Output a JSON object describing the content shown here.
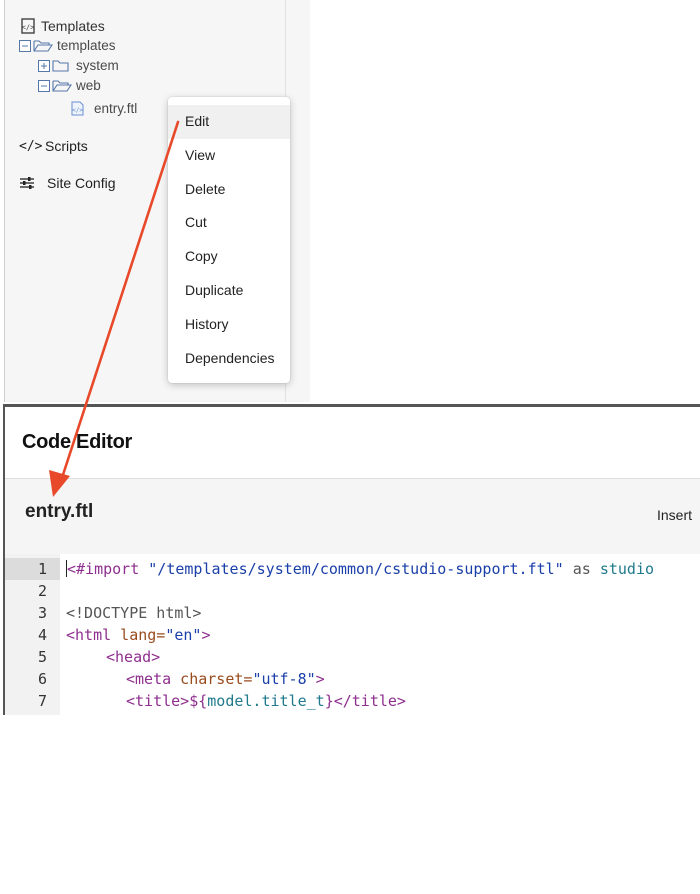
{
  "tree": {
    "root_label": "Templates",
    "folders": [
      {
        "label": "templates"
      },
      {
        "label": "system"
      },
      {
        "label": "web"
      }
    ],
    "file_label": "entry.ftl",
    "sections": [
      {
        "label": "Scripts",
        "icon": "code-icon"
      },
      {
        "label": "Site Config",
        "icon": "sliders-icon"
      }
    ]
  },
  "context_menu": {
    "items": [
      "Edit",
      "View",
      "Delete",
      "Cut",
      "Copy",
      "Duplicate",
      "History",
      "Dependencies"
    ],
    "highlighted": "Edit"
  },
  "editor": {
    "title": "Code Editor",
    "file_name": "entry.ftl",
    "insert_label": "Insert",
    "line_numbers": [
      "1",
      "2",
      "3",
      "4",
      "5",
      "6",
      "7"
    ],
    "code": {
      "l1_a": "<#import",
      "l1_b": " \"/templates/system/common/cstudio-support.ftl\"",
      "l1_c": " as",
      "l1_d": " studio",
      "l3": "<!DOCTYPE html>",
      "l4_a": "<html",
      "l4_b": " lang=",
      "l4_c": "\"en\"",
      "l4_d": ">",
      "l5": "<head>",
      "l6_a": "<meta",
      "l6_b": " charset=",
      "l6_c": "\"utf-8\"",
      "l6_d": ">",
      "l7_a": "<title>",
      "l7_b": "${",
      "l7_c": "model.title_t",
      "l7_d": "}",
      "l7_e": "</title>"
    }
  },
  "colors": {
    "arrow": "#e8492a",
    "folder_outline": "#5577aa",
    "file_icon": "#6a8fd0"
  }
}
